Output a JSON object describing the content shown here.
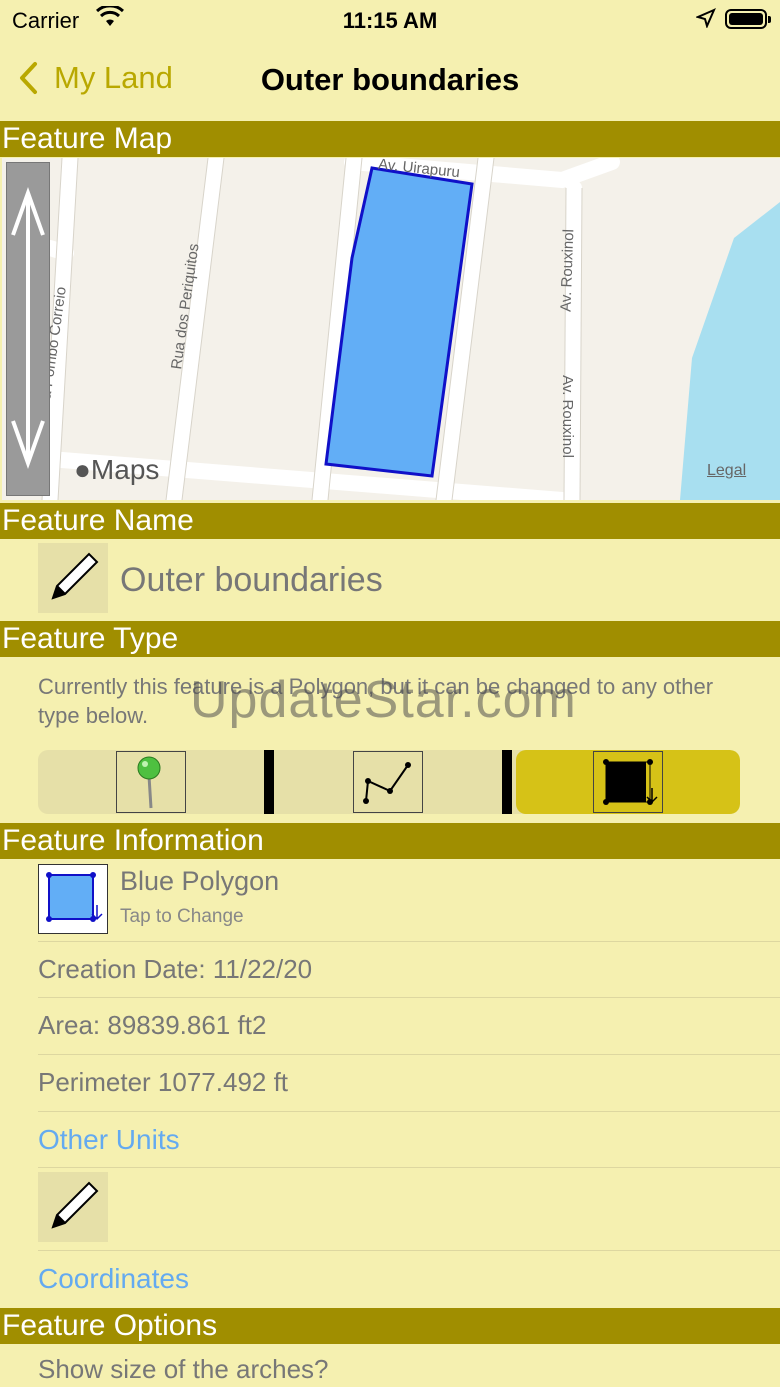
{
  "status": {
    "carrier": "Carrier",
    "time": "11:15 AM"
  },
  "nav": {
    "back_label": "My Land",
    "title": "Outer boundaries"
  },
  "sections": {
    "map": "Feature Map",
    "name": "Feature Name",
    "type": "Feature Type",
    "info": "Feature Information",
    "options": "Feature Options"
  },
  "map": {
    "streets": [
      "Av. Uirapuru",
      "Rua dos Periquitos",
      "Rua Pombo Correio",
      "Av. Rouxinol",
      "Av. Rouxinol"
    ],
    "logo": "Maps",
    "legal": "Legal",
    "polygon_fill": "#62aef6",
    "polygon_stroke": "#1010c8",
    "water_color": "#a8dff0"
  },
  "feature_name": {
    "value": "Outer boundaries",
    "edit_icon": "pencil-icon"
  },
  "feature_type": {
    "description": "Currently this feature is a Polygon, but it can be changed to any other type below.",
    "options": [
      "pin-icon",
      "polyline-icon",
      "polygon-icon"
    ],
    "selected": "polygon-icon",
    "selected_color": "#d6c217"
  },
  "feature_info": {
    "style_title": "Blue Polygon",
    "style_subtitle": "Tap to Change",
    "creation_date": "Creation Date: 11/22/20",
    "area": "Area:  89839.861 ft2",
    "perimeter": "Perimeter 1077.492 ft",
    "other_units": "Other Units",
    "coordinates": "Coordinates"
  },
  "feature_options": {
    "first_option": "Show size of the arches?"
  },
  "watermark": "UpdateStar.com",
  "colors": {
    "background": "#f5f0b0",
    "header": "#a08e00",
    "accent": "#b9a800",
    "link": "#64aaf0"
  }
}
